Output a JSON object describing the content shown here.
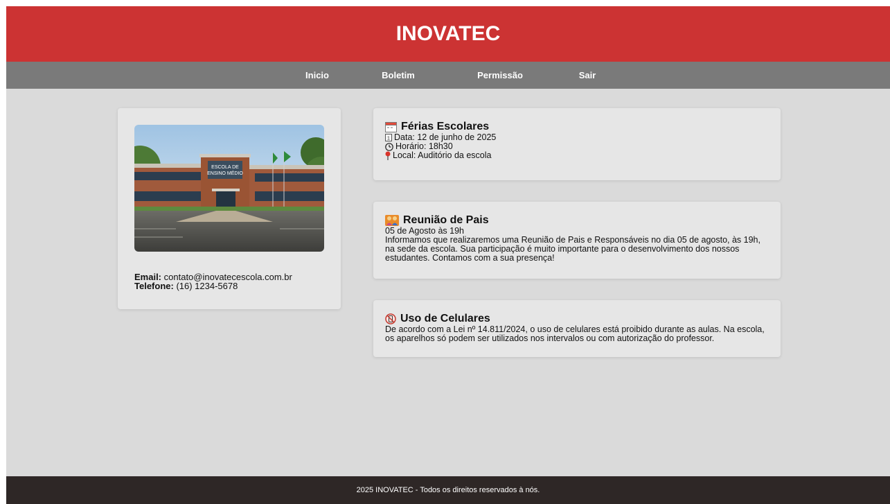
{
  "header": {
    "title": "INOVATEC"
  },
  "nav": {
    "items": [
      {
        "label": "Inicio"
      },
      {
        "label": "Boletim"
      },
      {
        "label": "Permissão"
      },
      {
        "label": "Sair"
      }
    ]
  },
  "school": {
    "sign_line1": "ESCOLA DE",
    "sign_line2": "ENSINO MÉDIO",
    "email_label": "Email:",
    "email": "contato@inovatecescola.com.br",
    "phone_label": "Telefone:",
    "phone": "(16) 1234-5678"
  },
  "events": {
    "ferias": {
      "title": "Férias Escolares",
      "date": "Data: 12 de junho de 2025",
      "time": "Horário: 18h30",
      "place": "Local: Auditório da escola"
    },
    "reuniao": {
      "title": "Reunião de Pais",
      "subtitle": "05 de Agosto às 19h",
      "text": "Informamos que realizaremos uma Reunião de Pais e Responsáveis no dia 05 de agosto, às 19h, na sede da escola. Sua participação é muito importante para o desenvolvimento dos nossos estudantes. Contamos com a sua presença!"
    },
    "celulares": {
      "title": "Uso de Celulares",
      "text": "De acordo com a Lei nº 14.811/2024, o uso de celulares está proibido durante as aulas. Na escola, os aparelhos só podem ser utilizados nos intervalos ou com autorização do professor."
    }
  },
  "footer": {
    "text": "2025 INOVATEC - Todos os direitos reservados à nós."
  },
  "colors": {
    "header": "#cc3333",
    "nav": "#7a7a7a",
    "page_background": "#dadada",
    "card": "#e6e6e6",
    "footer": "#2e2726"
  },
  "icons": [
    "calendar-icon",
    "date-icon",
    "clock-icon",
    "pin-icon",
    "family-icon",
    "no-phone-icon"
  ]
}
